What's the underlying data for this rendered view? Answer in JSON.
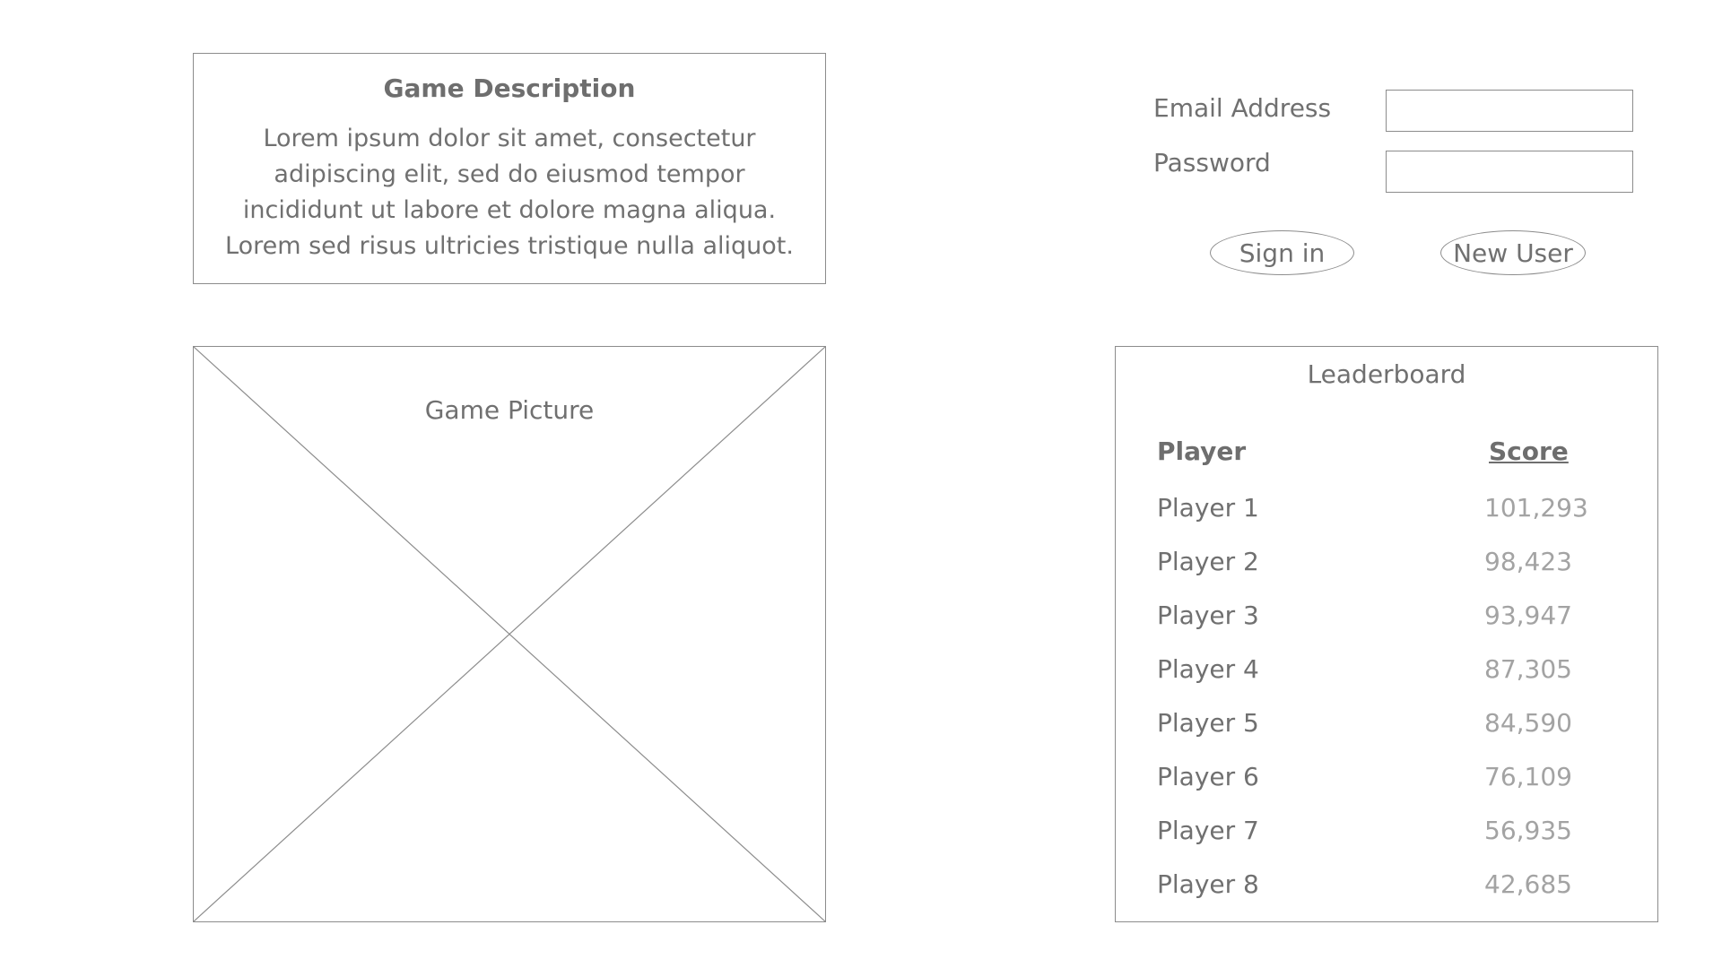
{
  "game_description": {
    "title": "Game Description",
    "text": "Lorem ipsum dolor sit amet, consectetur adipiscing elit, sed do eiusmod tempor incididunt ut labore et dolore magna aliqua. Lorem sed risus ultricies tristique nulla aliquot."
  },
  "game_picture": {
    "label": "Game Picture"
  },
  "login": {
    "email_label": "Email Address",
    "email_value": "",
    "password_label": "Password",
    "password_value": "",
    "signin_label": "Sign in",
    "newuser_label": "New User"
  },
  "leaderboard": {
    "title": "Leaderboard",
    "header_player": "Player",
    "header_score": "Score",
    "rows": [
      {
        "player": "Player 1",
        "score": "101,293"
      },
      {
        "player": "Player 2",
        "score": "98,423"
      },
      {
        "player": "Player 3",
        "score": "93,947"
      },
      {
        "player": "Player 4",
        "score": "87,305"
      },
      {
        "player": "Player 5",
        "score": "84,590"
      },
      {
        "player": "Player 6",
        "score": "76,109"
      },
      {
        "player": "Player 7",
        "score": "56,935"
      },
      {
        "player": "Player 8",
        "score": "42,685"
      }
    ]
  }
}
